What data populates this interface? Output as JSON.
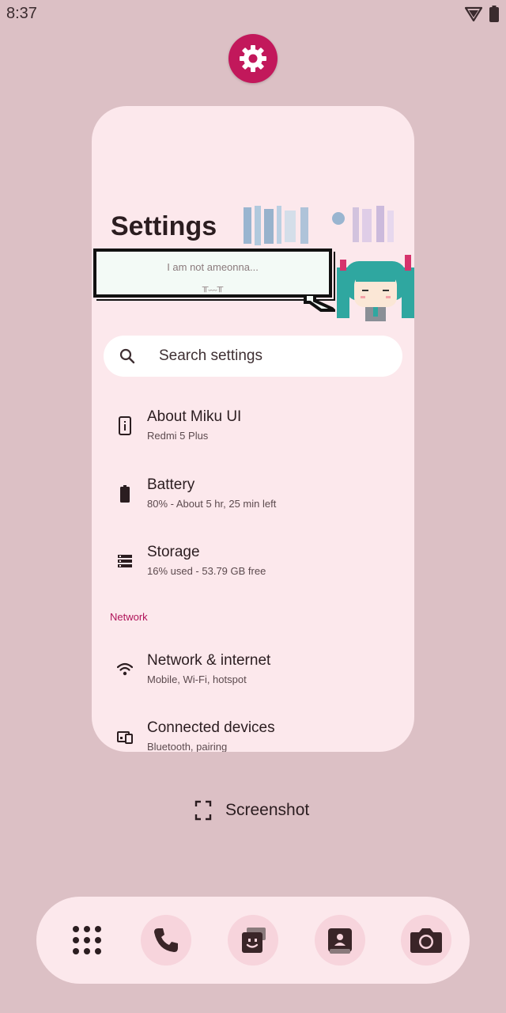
{
  "status_bar": {
    "time": "8:37"
  },
  "card": {
    "title": "Settings",
    "bubble": {
      "line1": "I am not ameonna...",
      "line2": "╥﹏╥"
    },
    "search": {
      "placeholder": "Search settings"
    },
    "items": [
      {
        "title": "About Miku UI",
        "subtitle": "Redmi 5 Plus",
        "icon": "phone-info-icon"
      },
      {
        "title": "Battery",
        "subtitle": "80% - About 5 hr, 25 min left",
        "icon": "battery-icon"
      },
      {
        "title": "Storage",
        "subtitle": "16% used - 53.79 GB free",
        "icon": "storage-icon"
      },
      {
        "title": "Network & internet",
        "subtitle": "Mobile, Wi‑Fi, hotspot",
        "icon": "wifi-icon"
      },
      {
        "title": "Connected devices",
        "subtitle": "Bluetooth, pairing",
        "icon": "devices-icon"
      }
    ],
    "section_network": "Network"
  },
  "actions": {
    "screenshot_label": "Screenshot"
  },
  "dock": {
    "apps": [
      "app-drawer-icon",
      "phone-icon",
      "messages-icon",
      "contacts-icon",
      "camera-icon"
    ]
  },
  "colors": {
    "background": "#dcc0c5",
    "card": "#fce8ec",
    "accent": "#c2185b",
    "section_label": "#b0145a"
  }
}
